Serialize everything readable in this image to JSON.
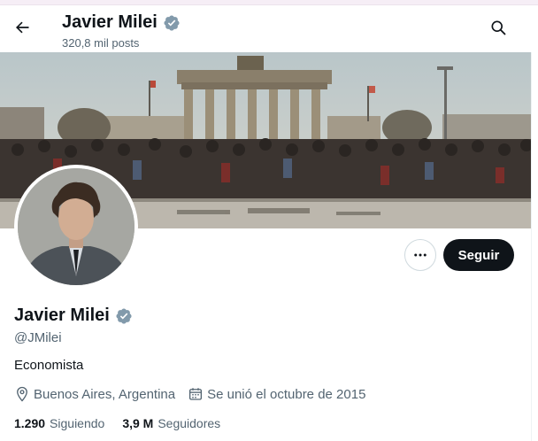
{
  "header": {
    "name": "Javier Milei",
    "posts_count": "320,8 mil posts"
  },
  "profile": {
    "name": "Javier Milei",
    "handle": "@JMilei",
    "bio": "Economista",
    "location": "Buenos Aires, Argentina",
    "joined": "Se unió el octubre de 2015",
    "following_count": "1.290",
    "following_label": "Siguiendo",
    "followers_count": "3,9 M",
    "followers_label": "Seguidores"
  },
  "actions": {
    "follow_label": "Seguir"
  },
  "icons": {
    "back": "arrow-left-icon",
    "search": "search-icon",
    "verified": "verified-badge-icon",
    "more": "more-dots-icon",
    "location": "location-pin-icon",
    "calendar": "calendar-icon"
  },
  "colors": {
    "verified": "#829aab",
    "primary_text": "#0f1419",
    "secondary_text": "#536471",
    "follow_button": "#0f1419"
  }
}
